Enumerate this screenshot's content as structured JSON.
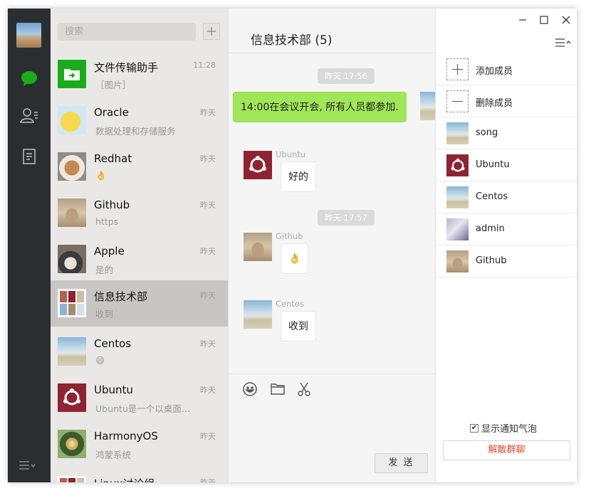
{
  "search": {
    "placeholder": "搜索"
  },
  "conversations": [
    {
      "name": "文件传输助手",
      "msg": "［图片］",
      "time": "11:28"
    },
    {
      "name": "Oracle",
      "msg": "数据处理和存储服务",
      "time": "昨天"
    },
    {
      "name": "Redhat",
      "msg": "👌",
      "time": "昨天"
    },
    {
      "name": "Github",
      "msg": "https",
      "time": "昨天"
    },
    {
      "name": "Apple",
      "msg": "是的",
      "time": "昨天"
    },
    {
      "name": "信息技术部",
      "msg": "收到",
      "time": "昨天"
    },
    {
      "name": "Centos",
      "msg": "😄",
      "time": "昨天"
    },
    {
      "name": "Ubuntu",
      "msg": "Ubuntu是一个以桌面…",
      "time": "昨天"
    },
    {
      "name": "HarmonyOS",
      "msg": "鸿蒙系统",
      "time": "昨天"
    },
    {
      "name": "Linux讨论组",
      "msg": "",
      "time": "昨天"
    }
  ],
  "chat": {
    "title": "信息技术部 (5)",
    "timestamps": [
      "昨天 17:56",
      "昨天 17:57"
    ],
    "messages": [
      {
        "sender": "",
        "text": "14:00在会议开会, 所有人员都参加."
      },
      {
        "sender": "Ubuntu",
        "text": "好的"
      },
      {
        "sender": "Github",
        "text": "👌"
      },
      {
        "sender": "Centos",
        "text": "收到"
      }
    ],
    "send_label": "发 送"
  },
  "panel": {
    "actions": [
      "添加成员",
      "删除成员"
    ],
    "members": [
      "song",
      "Ubuntu",
      "Centos",
      "admin",
      "Github"
    ],
    "notify_label": "显示通知气泡",
    "notify_checked": true,
    "dissolve_label": "解散群聊"
  },
  "colors": {
    "accent": "#1aad19",
    "bubble_self": "#9fe658",
    "danger": "#e0462e",
    "sidebar": "#2b2e31"
  }
}
